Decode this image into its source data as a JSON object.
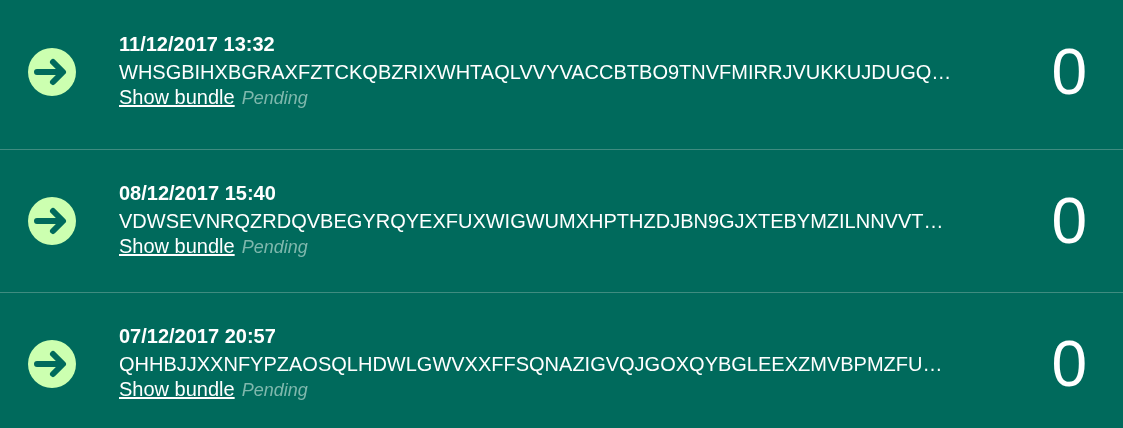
{
  "transactions": [
    {
      "date": "11/12/2017 13:32",
      "address": "WHSGBIHXBGRAXFZTCKQBZRIXWHTAQLVVYVACCBTBO9TNVFMIRRJVUKKUJDUGQ…",
      "link": "Show bundle",
      "status": "Pending",
      "value": "0"
    },
    {
      "date": "08/12/2017 15:40",
      "address": "VDWSEVNRQZRDQVBEGYRQYEXFUXWIGWUMXHPTHZDJBN9GJXTEBYMZILNNVVT…",
      "link": "Show bundle",
      "status": "Pending",
      "value": "0"
    },
    {
      "date": "07/12/2017 20:57",
      "address": "QHHBJJXXNFYPZAOSQLHDWLGWVXXFFSQNAZIGVQJGOXQYBGLEEXZMVBPMZFU…",
      "link": "Show bundle",
      "status": "Pending",
      "value": "0"
    }
  ]
}
